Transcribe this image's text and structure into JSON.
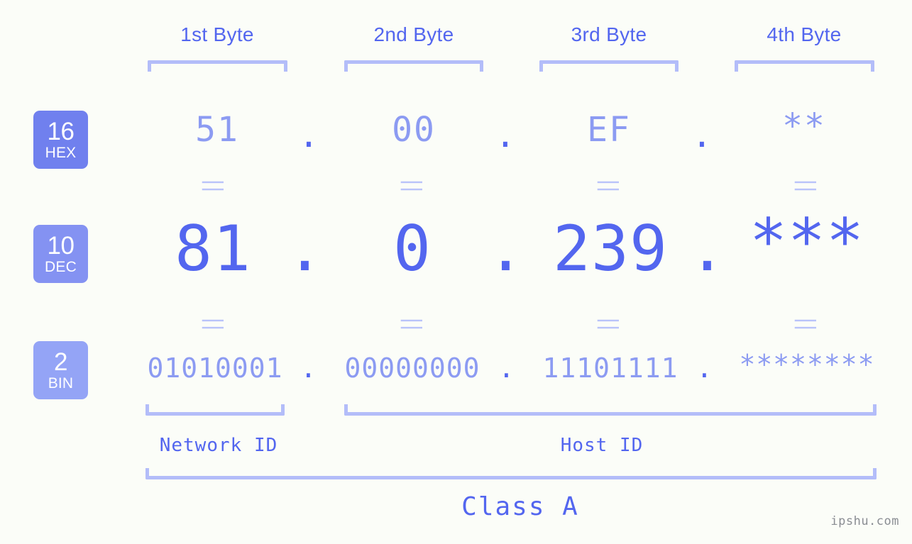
{
  "background_color": "#fbfdf8",
  "accent_dark": "#5366ef",
  "accent_light": "#8c9bf2",
  "bracket_color": "#b3bdf9",
  "connector_color": "#b9c3fa",
  "byte_headers": [
    {
      "label": "1st Byte"
    },
    {
      "label": "2nd Byte"
    },
    {
      "label": "3rd Byte"
    },
    {
      "label": "4th Byte"
    }
  ],
  "bases": [
    {
      "num": "16",
      "unit": "HEX",
      "color": "#7080ee"
    },
    {
      "num": "10",
      "unit": "DEC",
      "color": "#8492f2"
    },
    {
      "num": "2",
      "unit": "BIN",
      "color": "#94a4f6"
    }
  ],
  "rows": {
    "hex": {
      "base_label": "HEX",
      "values": [
        "51",
        "00",
        "EF",
        "**"
      ],
      "separator": "."
    },
    "dec": {
      "base_label": "DEC",
      "values": [
        "81",
        "0",
        "239",
        "***"
      ],
      "separator": "."
    },
    "bin": {
      "base_label": "BIN",
      "values": [
        "01010001",
        "00000000",
        "11101111",
        "********"
      ],
      "separator": "."
    }
  },
  "connector_symbol": "||",
  "segments": {
    "network_id": "Network ID",
    "host_id": "Host ID",
    "class": "Class A"
  },
  "watermark": "ipshu.com"
}
